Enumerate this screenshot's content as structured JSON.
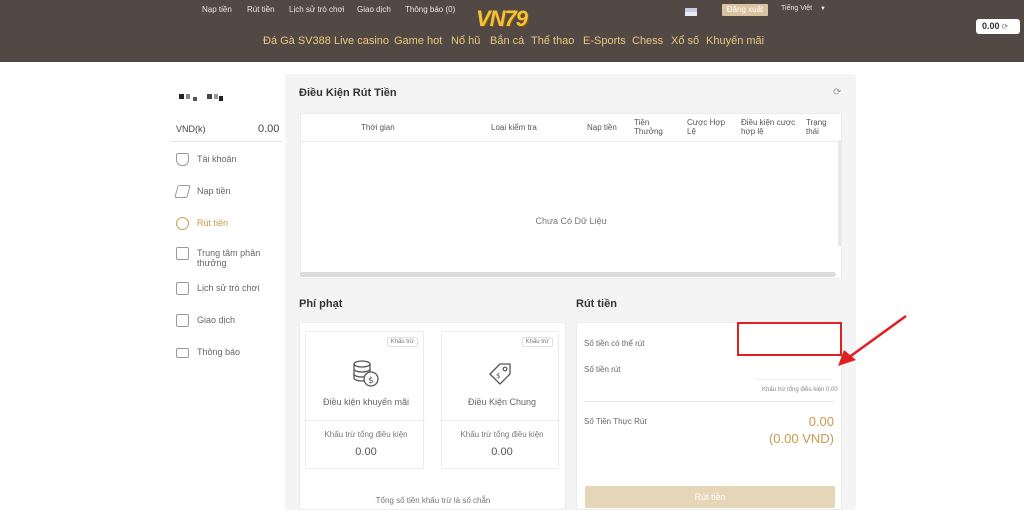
{
  "header": {
    "top_links": [
      "Nạp tiền",
      "Rút tiền",
      "Lịch sử trò chơi",
      "Giao dịch",
      "Thông báo (0)"
    ],
    "logo": "VN79",
    "logout": "Đăng xuất",
    "language": "Tiếng Việt",
    "balance": "0.00",
    "nav": [
      "Đá Gà SV388",
      "Live casino",
      "Game hot",
      "Nổ hũ",
      "Bắn cá",
      "Thể thao",
      "E-Sports",
      "Chess",
      "Xổ số",
      "Khuyến mãi"
    ]
  },
  "sidebar": {
    "currency": "VND(k)",
    "balance": "0.00",
    "items": [
      {
        "label": "Tài khoản",
        "icon": "user-shield-icon"
      },
      {
        "label": "Nạp tiền",
        "icon": "send-icon"
      },
      {
        "label": "Rút tiền",
        "icon": "coins-icon"
      },
      {
        "label": "Trung tâm phần thưởng",
        "icon": "gift-icon"
      },
      {
        "label": "Lịch sử trò chơi",
        "icon": "history-icon"
      },
      {
        "label": "Giao dịch",
        "icon": "bank-icon"
      },
      {
        "label": "Thông báo",
        "icon": "mail-icon"
      }
    ]
  },
  "conditions": {
    "title": "Điều Kiện Rút Tiền",
    "columns": [
      "Thời gian",
      "Loại kiểm tra",
      "Nạp tiền",
      "Tiền Thưởng",
      "Cược Hợp Lệ",
      "Điều kiện cược hợp lệ",
      "Trạng thái"
    ],
    "empty": "Chưa Có Dữ Liệu"
  },
  "penalty": {
    "title": "Phí phạt",
    "cards": [
      {
        "tag": "Khấu trừ",
        "title": "Điều kiện khuyến mãi",
        "sub": "Khấu trừ tổng điều kiện",
        "value": "0.00"
      },
      {
        "tag": "Khấu trừ",
        "title": "Điều Kiện Chung",
        "sub": "Khấu trừ tổng điều kiện",
        "value": "0.00"
      }
    ],
    "footnote": "Tổng số tiền khấu trừ là số chẵn"
  },
  "withdraw": {
    "title": "Rút tiền",
    "available_label": "Số tiền có thể rút",
    "amount_label": "Số tiền rút",
    "deduct_note": "Khấu trừ tổng điều kiện 0.00",
    "actual_label": "Số Tiền Thực Rút",
    "actual_value": "0.00",
    "actual_vnd": "(0.00 VND)",
    "button": "Rút tiền"
  },
  "colors": {
    "header_bg": "#524944",
    "accent": "#c99b4d",
    "annotation": "#e02020"
  }
}
